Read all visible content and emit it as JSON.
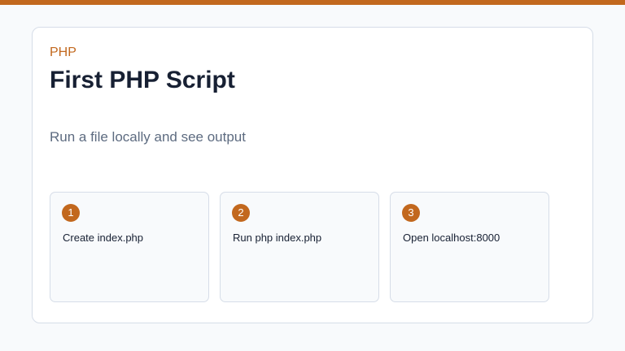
{
  "header": {
    "eyebrow": "PHP",
    "title": "First PHP Script",
    "subtitle": "Run a file locally and see output"
  },
  "steps": [
    {
      "number": "1",
      "text": "Create index.php"
    },
    {
      "number": "2",
      "text": "Run php index.php"
    },
    {
      "number": "3",
      "text": "Open localhost:8000"
    }
  ],
  "colors": {
    "accent": "#c2681e",
    "title": "#172033",
    "subtitle": "#5d6b80",
    "border": "#d6dde8",
    "background": "#f8fafc"
  }
}
